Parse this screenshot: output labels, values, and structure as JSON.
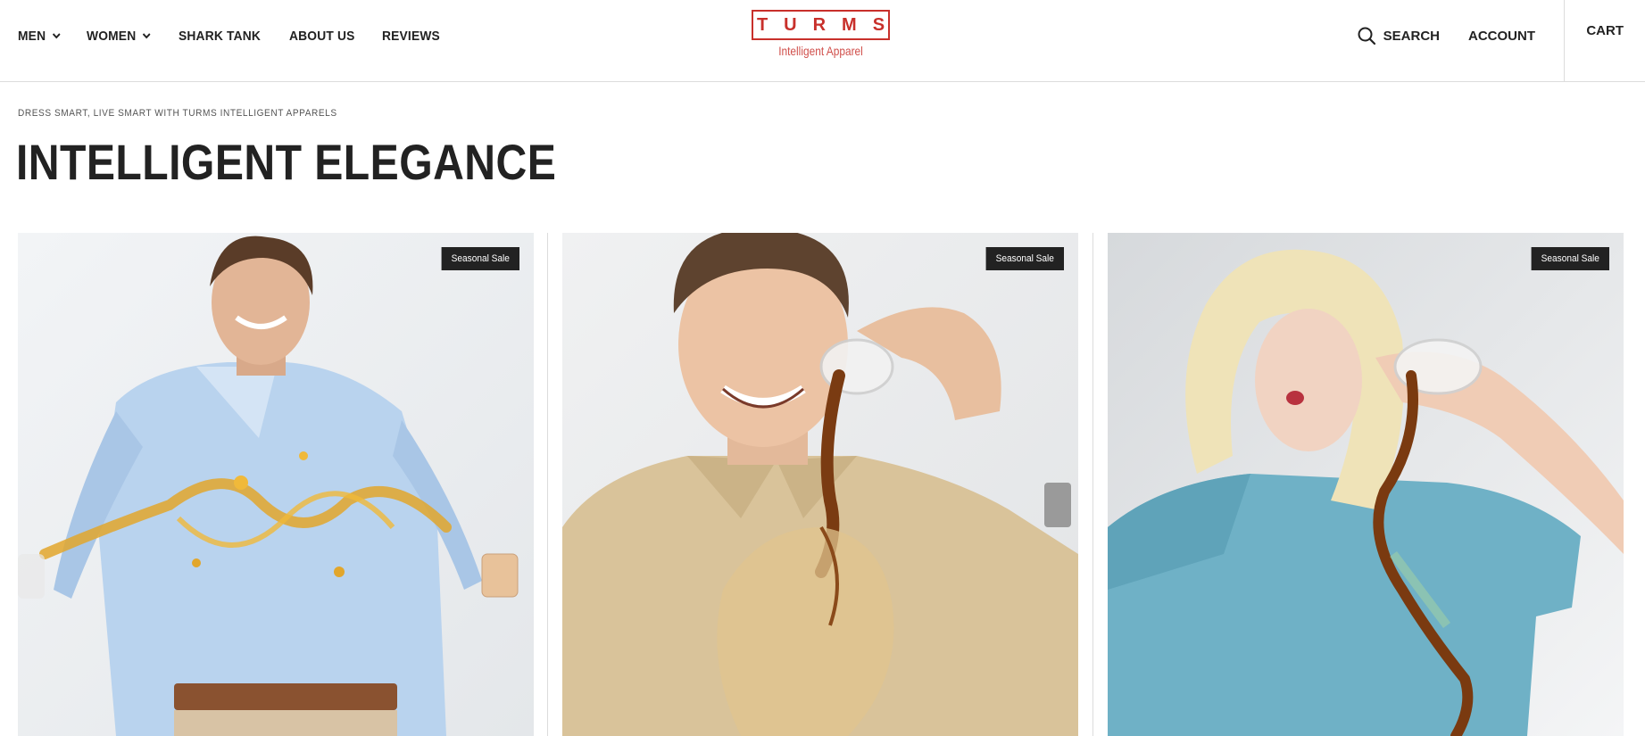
{
  "header": {
    "nav_left": [
      {
        "label": "MEN",
        "has_dropdown": true
      },
      {
        "label": "WOMEN",
        "has_dropdown": true
      },
      {
        "label": "SHARK TANK",
        "has_dropdown": false
      },
      {
        "label": "ABOUT US",
        "has_dropdown": false
      },
      {
        "label": "REVIEWS",
        "has_dropdown": false
      }
    ],
    "logo": {
      "wordmark": "TURMS",
      "tagline": "Intelligent Apparel"
    },
    "search_label": "SEARCH",
    "account_label": "ACCOUNT",
    "cart_label": "CART"
  },
  "hero": {
    "eyebrow": "DRESS SMART, LIVE SMART WITH TURMS INTELLIGENT APPARELS",
    "title": "INTELLIGENT ELEGANCE"
  },
  "products": [
    {
      "badge": "Seasonal Sale",
      "image": "man-in-light-blue-shirt-with-juice-splash"
    },
    {
      "badge": "Seasonal Sale",
      "image": "man-in-beige-polo-pouring-coffee"
    },
    {
      "badge": "Seasonal Sale",
      "image": "woman-in-blue-tshirt-spilling-coffee"
    }
  ],
  "colors": {
    "brand_red": "#c8302b",
    "text_dark": "#222222",
    "badge_bg": "#222222",
    "divider": "#dcdcdc"
  }
}
